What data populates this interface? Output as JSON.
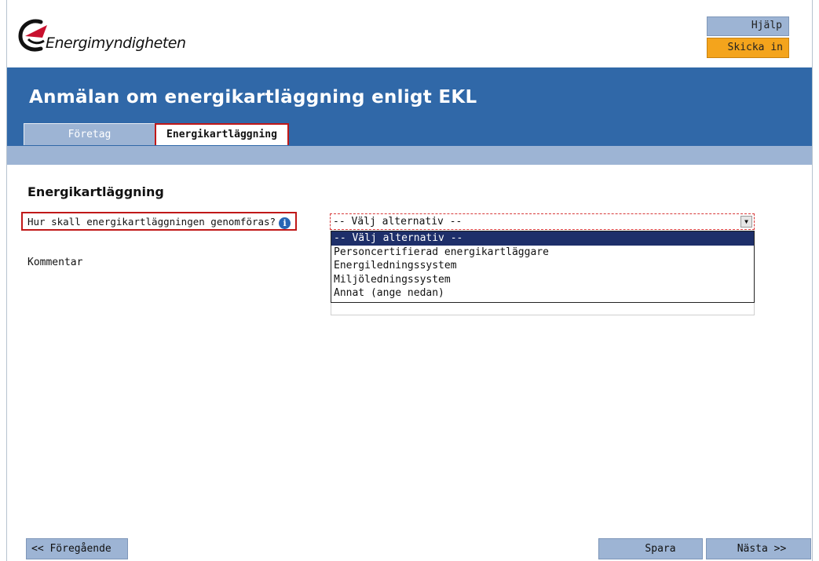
{
  "header": {
    "logo_text": "Energimyndigheten",
    "help_label": "Hjälp",
    "submit_label": "Skicka in"
  },
  "band": {
    "title": "Anmälan om energikartläggning enligt EKL"
  },
  "tabs": [
    {
      "label": "Företag",
      "active": false
    },
    {
      "label": "Energikartläggning",
      "active": true
    }
  ],
  "main": {
    "section_title": "Energikartläggning",
    "question_label": "Hur skall energikartläggningen genomföras?",
    "info_icon": "info-icon",
    "comment_label": "Kommentar",
    "select": {
      "value": "-- Välj alternativ --",
      "options": [
        "-- Välj alternativ --",
        "Personcertifierad energikartläggare",
        "Energiledningssystem",
        "Miljöledningssystem",
        "Annat (ange nedan)"
      ],
      "selected_index": 0
    }
  },
  "footer": {
    "prev_label": "<< Föregående",
    "save_label": "Spara",
    "next_label": "Nästa >>"
  },
  "colors": {
    "band": "#3068a8",
    "light_band": "#9db4d4",
    "submit": "#f4a41c",
    "highlight": "#c01818",
    "selected_option": "#1e2f6a"
  }
}
